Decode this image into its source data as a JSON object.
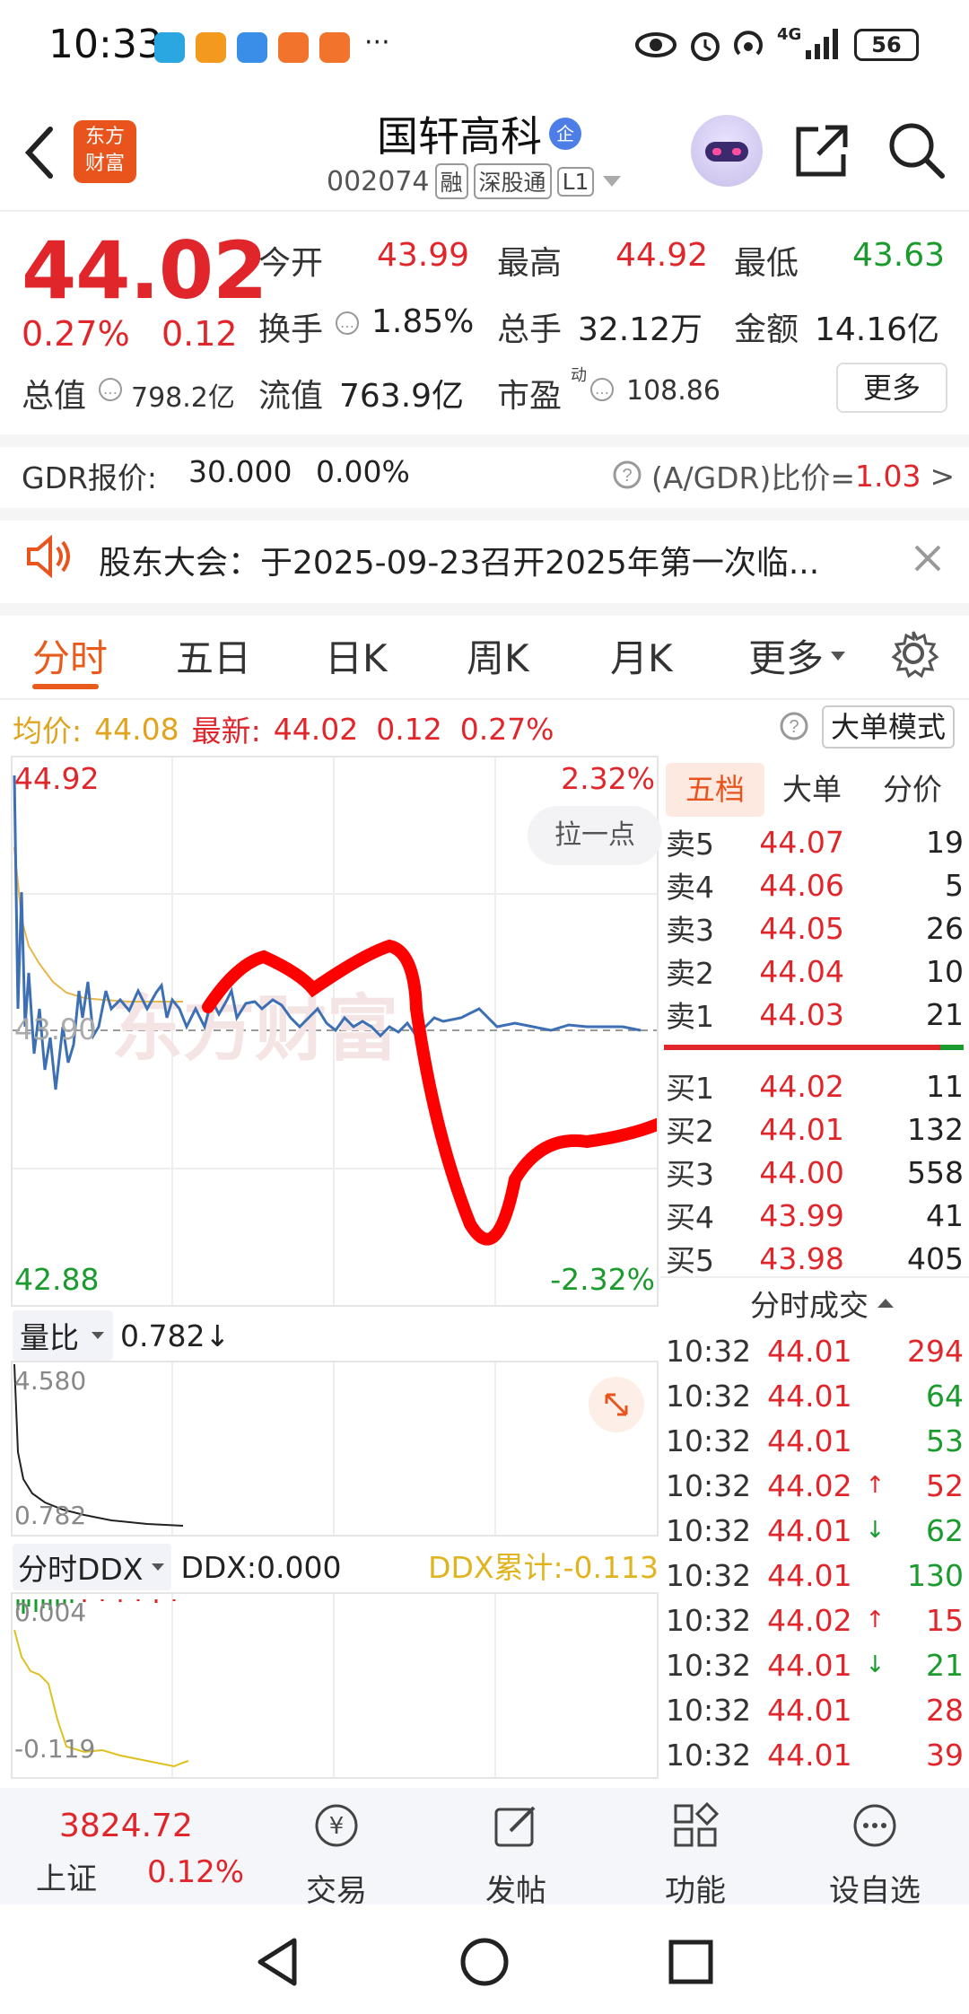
{
  "status_bar": {
    "time": "10:33",
    "app_icons": [
      "#2aa6e0",
      "#f39a1e",
      "#3b8ee8",
      "#f1732c",
      "#f1732c"
    ],
    "more": "···",
    "network": "4G",
    "battery": "56"
  },
  "header": {
    "logo_text_1": "东方",
    "logo_text_2": "财富",
    "title": "国轩高科",
    "badge": "企",
    "code": "002074",
    "tags": [
      "融",
      "深股通",
      "L1"
    ]
  },
  "quote": {
    "price": "44.02",
    "change_pct": "0.27%",
    "change": "0.12",
    "open_label": "今开",
    "open": "43.99",
    "high_label": "最高",
    "high": "44.92",
    "low_label": "最低",
    "low": "43.63",
    "turnover_label": "换手",
    "turnover": "1.85%",
    "volume_label": "总手",
    "volume": "32.12万",
    "amount_label": "金额",
    "amount": "14.16亿",
    "mktcap_label": "总值",
    "mktcap": "798.2亿",
    "float_label": "流值",
    "float": "763.9亿",
    "pe_label": "市盈",
    "pe_sup": "动",
    "pe": "108.86",
    "more_label": "更多"
  },
  "gdr": {
    "label": "GDR报价:",
    "price": "30.000",
    "pct": "0.00%",
    "ratio_label": "(A/GDR)比价=",
    "ratio": "1.03",
    "arrow": ">"
  },
  "notice": {
    "text": "股东大会：于2025-09-23召开2025年第一次临..."
  },
  "tabs": [
    "分时",
    "五日",
    "日K",
    "周K",
    "月K",
    "更多"
  ],
  "chart_header": {
    "avg_label": "均价:",
    "avg": "44.08",
    "latest_label": "最新:",
    "latest": "44.02",
    "chg": "0.12",
    "pct": "0.27%",
    "big_order_mode": "大单模式"
  },
  "chart": {
    "top_price": "44.92",
    "top_pct": "2.32%",
    "mid_price": "43.90",
    "bottom_price": "42.88",
    "bottom_pct": "-2.32%",
    "watermark": "东方财富",
    "drag_hint": "拉一点",
    "colors": {
      "price_line": "#3d6fb5",
      "avg_line": "#e8b64a",
      "annotation": "#ff0000"
    }
  },
  "volume_ratio": {
    "label": "量比",
    "value": "0.782",
    "arrow": "↓",
    "top": "4.580",
    "bottom": "0.782"
  },
  "ddx": {
    "label": "分时DDX",
    "value_label": "DDX:0.000",
    "cum_label": "DDX累计:-0.113",
    "top": "0.004",
    "bottom": "-0.119"
  },
  "order_book": {
    "tabs": [
      "五档",
      "大单",
      "分价"
    ],
    "asks": [
      {
        "label": "卖5",
        "price": "44.07",
        "qty": "19"
      },
      {
        "label": "卖4",
        "price": "44.06",
        "qty": "5"
      },
      {
        "label": "卖3",
        "price": "44.05",
        "qty": "26"
      },
      {
        "label": "卖2",
        "price": "44.04",
        "qty": "10"
      },
      {
        "label": "卖1",
        "price": "44.03",
        "qty": "21"
      }
    ],
    "bids": [
      {
        "label": "买1",
        "price": "44.02",
        "qty": "11"
      },
      {
        "label": "买2",
        "price": "44.01",
        "qty": "132"
      },
      {
        "label": "买3",
        "price": "44.00",
        "qty": "558"
      },
      {
        "label": "买4",
        "price": "43.99",
        "qty": "41"
      },
      {
        "label": "买5",
        "price": "43.98",
        "qty": "405"
      }
    ]
  },
  "trades": {
    "title": "分时成交",
    "rows": [
      {
        "time": "10:32",
        "price": "44.01",
        "arrow": "",
        "vol": "294",
        "dir": "red"
      },
      {
        "time": "10:32",
        "price": "44.01",
        "arrow": "",
        "vol": "64",
        "dir": "green"
      },
      {
        "time": "10:32",
        "price": "44.01",
        "arrow": "",
        "vol": "53",
        "dir": "green"
      },
      {
        "time": "10:32",
        "price": "44.02",
        "arrow": "↑",
        "vol": "52",
        "dir": "red"
      },
      {
        "time": "10:32",
        "price": "44.01",
        "arrow": "↓",
        "vol": "62",
        "dir": "green"
      },
      {
        "time": "10:32",
        "price": "44.01",
        "arrow": "",
        "vol": "130",
        "dir": "green"
      },
      {
        "time": "10:32",
        "price": "44.02",
        "arrow": "↑",
        "vol": "15",
        "dir": "red"
      },
      {
        "time": "10:32",
        "price": "44.01",
        "arrow": "↓",
        "vol": "21",
        "dir": "green"
      },
      {
        "time": "10:32",
        "price": "44.01",
        "arrow": "",
        "vol": "28",
        "dir": "red"
      },
      {
        "time": "10:32",
        "price": "44.01",
        "arrow": "",
        "vol": "39",
        "dir": "red"
      }
    ]
  },
  "bottom_bar": {
    "index_value": "3824.72",
    "index_name": "上证",
    "index_pct": "0.12%",
    "items": [
      "交易",
      "发帖",
      "功能",
      "设自选"
    ]
  }
}
